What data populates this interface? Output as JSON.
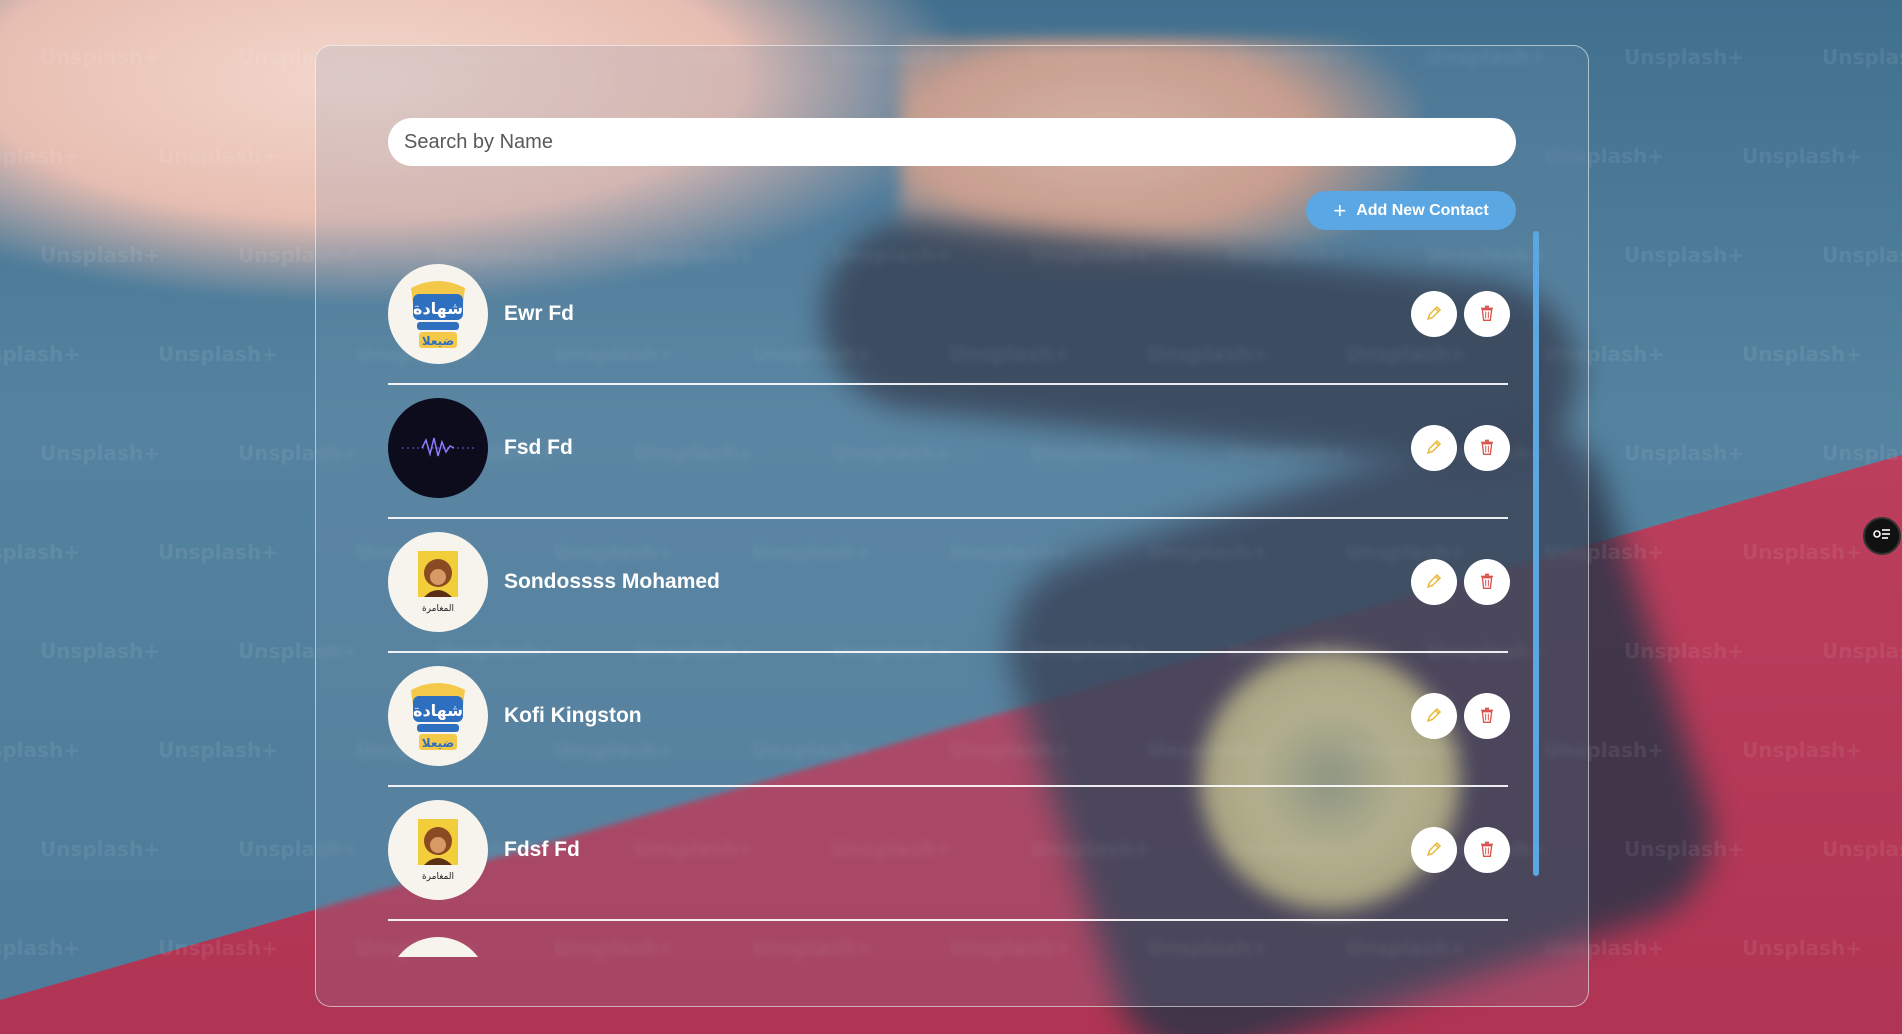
{
  "background": {
    "watermark_text": "Unsplash+"
  },
  "search": {
    "placeholder": "Search by Name",
    "value": ""
  },
  "toolbar": {
    "add_label": "Add New Contact",
    "add_icon": "plus-icon"
  },
  "contacts": [
    {
      "name": "Ewr Fd",
      "avatar": "arabic-logo-blue"
    },
    {
      "name": "Fsd Fd",
      "avatar": "dark-waveform"
    },
    {
      "name": "Sondossss Mohamed",
      "avatar": "portrait-yellow"
    },
    {
      "name": "Kofi Kingston",
      "avatar": "arabic-logo-blue"
    },
    {
      "name": "Fdsf Fd",
      "avatar": "portrait-yellow"
    },
    {
      "name": "",
      "avatar": "blank"
    }
  ],
  "actions": {
    "edit_icon": "pencil-icon",
    "delete_icon": "trash-icon"
  },
  "colors": {
    "accent": "#5aa7e4",
    "edit": "#e9b93a",
    "delete": "#d9534f"
  }
}
